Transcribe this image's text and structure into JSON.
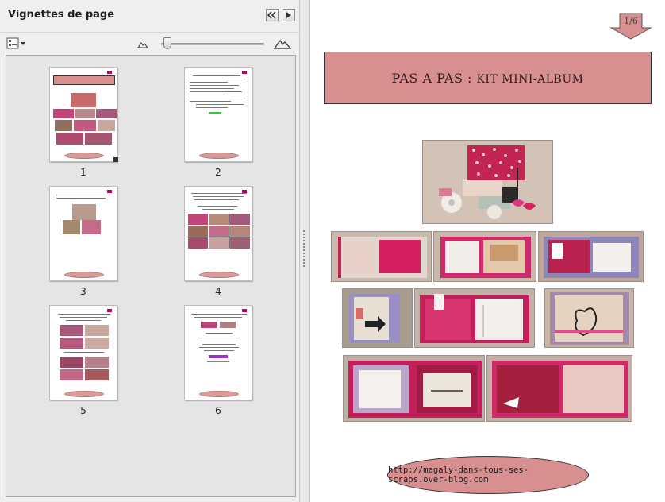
{
  "panel": {
    "title": "Vignettes de page",
    "buttons": {
      "collapse": "collapse-panel",
      "expand": "next-panel"
    },
    "thumbnails": [
      {
        "label": "1"
      },
      {
        "label": "2"
      },
      {
        "label": "3"
      },
      {
        "label": "4"
      },
      {
        "label": "5"
      },
      {
        "label": "6"
      }
    ]
  },
  "document": {
    "page_indicator": "1/6",
    "title_caps": "PAS A PAS",
    "title_sep": " : ",
    "title_rest": "KIT MINI-ALBUM",
    "footer_url": "http://magaly-dans-tous-ses-scraps.over-blog.com"
  },
  "colors": {
    "accent_pink": "#d88f8f",
    "deep_pink": "#c4245a",
    "panel_bg": "#efefef"
  }
}
